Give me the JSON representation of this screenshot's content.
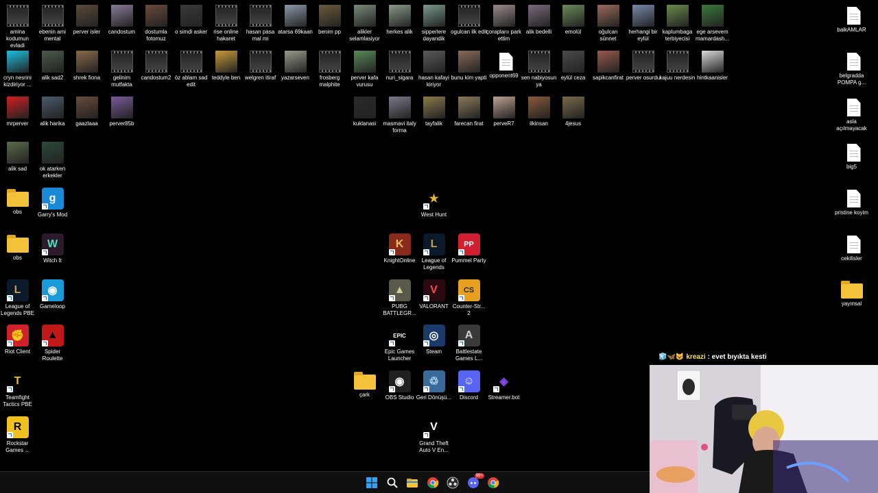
{
  "desktop": {
    "icons": [
      {
        "label": "amina kodumun evladi",
        "kind": "video"
      },
      {
        "label": "ebenin ami mental",
        "kind": "video"
      },
      {
        "label": "perver isler",
        "kind": "photo",
        "color": "#5a4a3a"
      },
      {
        "label": "candostum",
        "kind": "photo",
        "color": "#8a7a9a"
      },
      {
        "label": "dostumla fotomuz",
        "kind": "photo",
        "color": "#6a4a3a"
      },
      {
        "label": "o simdi asker",
        "kind": "photo",
        "color": "#3a3a3a"
      },
      {
        "label": "rise online hakaret",
        "kind": "video"
      },
      {
        "label": "hasan pasa mal mi",
        "kind": "video"
      },
      {
        "label": "atarsa 69kaan",
        "kind": "photo",
        "color": "#8a9aaa"
      },
      {
        "label": "benim pp",
        "kind": "photo",
        "color": "#6a5a3a"
      },
      {
        "label": "alikler selamlasiyor",
        "kind": "photo",
        "color": "#7a8a7a"
      },
      {
        "label": "herkes alik",
        "kind": "photo",
        "color": "#8a9a8a"
      },
      {
        "label": "sipperlere dayandik",
        "kind": "photo",
        "color": "#7a9a8a"
      },
      {
        "label": "ogulcan ilk edit",
        "kind": "video"
      },
      {
        "label": "çoraplarıı park ettim",
        "kind": "photo",
        "color": "#9a8a8a"
      },
      {
        "label": "alik bedelli",
        "kind": "photo",
        "color": "#7a6a7a"
      },
      {
        "label": "emolül",
        "kind": "photo",
        "color": "#6a8a5a"
      },
      {
        "label": "oğulcan sünnet",
        "kind": "photo",
        "color": "#9a6a5a"
      },
      {
        "label": "herhangi bir eylül",
        "kind": "photo",
        "color": "#7a8aaa"
      },
      {
        "label": "kaplumbaga terbiyecisi",
        "kind": "photo",
        "color": "#6a8a4a"
      },
      {
        "label": "ege arsevem mamardash...",
        "kind": "photo",
        "color": "#3a7a3a"
      },
      {
        "label": "balkAMLAR",
        "kind": "doc"
      },
      {
        "label": "cryn nesrini kizdiriyor ...",
        "kind": "photo",
        "color": "#1ec0e0"
      },
      {
        "label": "alik sad2",
        "kind": "photo",
        "color": "#4a5a4a"
      },
      {
        "label": "shrek fiona",
        "kind": "photo",
        "color": "#8a6a4a"
      },
      {
        "label": "gelinim mutfakta",
        "kind": "video"
      },
      {
        "label": "candostum2",
        "kind": "video"
      },
      {
        "label": "öz ablam sad edit",
        "kind": "video"
      },
      {
        "label": "teddyle ben",
        "kind": "photo",
        "color": "#c89a3a"
      },
      {
        "label": "welgren itiraf",
        "kind": "video"
      },
      {
        "label": "yazarseven",
        "kind": "photo",
        "color": "#9a9a8a"
      },
      {
        "label": "frosberg malphite",
        "kind": "video"
      },
      {
        "label": "perver kafa vurusu",
        "kind": "photo",
        "color": "#5a8a5a"
      },
      {
        "label": "nuri_sigara",
        "kind": "video"
      },
      {
        "label": "hasan kafayi kiriyor",
        "kind": "photo",
        "color": "#5a5a5a"
      },
      {
        "label": "bunu kim yapti",
        "kind": "photo",
        "color": "#8a6a5a"
      },
      {
        "label": "opponent69",
        "kind": "doc"
      },
      {
        "label": "sen nabiyosun ya",
        "kind": "video"
      },
      {
        "label": "eylül ceza",
        "kind": "photo",
        "color": "#4a4a4a"
      },
      {
        "label": "sapikcanfirat",
        "kind": "photo",
        "color": "#9a5a4a"
      },
      {
        "label": "perver osurdu",
        "kind": "video"
      },
      {
        "label": "kajuu nerdesin",
        "kind": "video"
      },
      {
        "label": "hintkaanisler",
        "kind": "photo",
        "color": "#dadada"
      },
      {
        "label": "belgradda POMPA g...",
        "kind": "doc"
      },
      {
        "label": "mrperver",
        "kind": "photo",
        "color": "#d02020"
      },
      {
        "label": "alik harika",
        "kind": "photo",
        "color": "#4a5a6a"
      },
      {
        "label": "gaazlaaa",
        "kind": "photo",
        "color": "#6a4a3a"
      },
      {
        "label": "perver85b",
        "kind": "photo",
        "color": "#7a5a9a"
      },
      {
        "label": "kuklanasi",
        "kind": "photo",
        "color": "#2a2a2a"
      },
      {
        "label": "masmavi italy forma",
        "kind": "photo",
        "color": "#7a7a8a"
      },
      {
        "label": "tayfalik",
        "kind": "photo",
        "color": "#8a7a4a"
      },
      {
        "label": "farecan firat",
        "kind": "photo",
        "color": "#8a7a5a"
      },
      {
        "label": "perveR7",
        "kind": "photo",
        "color": "#c0a090"
      },
      {
        "label": "ilkinsan",
        "kind": "photo",
        "color": "#8a5a3a"
      },
      {
        "label": "4jesus",
        "kind": "photo",
        "color": "#7a6a4a"
      },
      {
        "label": "asla açılmayacak",
        "kind": "doc"
      },
      {
        "label": "alik sad",
        "kind": "photo",
        "color": "#5a6a4a"
      },
      {
        "label": "ok atarken erkekler",
        "kind": "photo",
        "color": "#2a4a3a"
      },
      {
        "label": "big5",
        "kind": "doc"
      },
      {
        "label": "obs",
        "kind": "folder"
      },
      {
        "label": "Garry's Mod",
        "kind": "app",
        "color": "#1a8ad8",
        "glyph": "g"
      },
      {
        "label": "West Hunt",
        "kind": "app",
        "color": "#000000",
        "glyph": "★",
        "fg": "#e8b830"
      },
      {
        "label": "pristine koyim",
        "kind": "doc"
      },
      {
        "label": "obs",
        "kind": "folder"
      },
      {
        "label": "Witch It",
        "kind": "app",
        "color": "#2a1a2a",
        "glyph": "W",
        "fg": "#50e0c0"
      },
      {
        "label": "KnightOnline",
        "kind": "app",
        "color": "#8a2a1a",
        "glyph": "K",
        "fg": "#f0c060"
      },
      {
        "label": "League of Legends",
        "kind": "app",
        "color": "#0a1a2a",
        "glyph": "L",
        "fg": "#c8a050"
      },
      {
        "label": "Pummel Party",
        "kind": "app",
        "color": "#d02030",
        "glyph": "PP",
        "fg": "#ffffff"
      },
      {
        "label": "cekilisler",
        "kind": "doc"
      },
      {
        "label": "League of Legends PBE",
        "kind": "app",
        "color": "#0a1a2a",
        "glyph": "L",
        "fg": "#c8a050"
      },
      {
        "label": "Gameloop",
        "kind": "app",
        "color": "#1a9ad8",
        "glyph": "◉",
        "fg": "#ffffff"
      },
      {
        "label": "PUBG BATTLEGR...",
        "kind": "app",
        "color": "#5a5a4a",
        "glyph": "▲",
        "fg": "#d0c8a0"
      },
      {
        "label": "VALORANT",
        "kind": "app",
        "color": "#2a0a10",
        "glyph": "V",
        "fg": "#ff4655"
      },
      {
        "label": "Counter-Str... 2",
        "kind": "app",
        "color": "#e8a020",
        "glyph": "CS",
        "fg": "#1a2a4a"
      },
      {
        "label": "yayınsal",
        "kind": "folder"
      },
      {
        "label": "Riot Client",
        "kind": "app",
        "color": "#d0202a",
        "glyph": "✊",
        "fg": "#ffffff"
      },
      {
        "label": "Spider Roulette",
        "kind": "app",
        "color": "#c01818",
        "glyph": "▲",
        "fg": "#000000"
      },
      {
        "label": "Epic Games Launcher",
        "kind": "app",
        "color": "#000000",
        "glyph": "EPIC",
        "fg": "#ffffff"
      },
      {
        "label": "Steam",
        "kind": "app",
        "color": "#1a3a6a",
        "glyph": "◎",
        "fg": "#ffffff"
      },
      {
        "label": "Battlestate Games L...",
        "kind": "app",
        "color": "#3a3a3a",
        "glyph": "A",
        "fg": "#d0d0d0"
      },
      {
        "label": "Teamfight Tactics PBE",
        "kind": "app",
        "color": "#000000",
        "glyph": "T",
        "fg": "#e8c030"
      },
      {
        "label": "çark",
        "kind": "folder"
      },
      {
        "label": "OBS Studio",
        "kind": "app",
        "color": "#202020",
        "glyph": "◉",
        "fg": "#ffffff"
      },
      {
        "label": "Geri Dönüşü...",
        "kind": "app",
        "color": "#3a6a9a",
        "glyph": "♲",
        "fg": "#c0e0ff"
      },
      {
        "label": "Discord",
        "kind": "app",
        "color": "#5865f2",
        "glyph": "☺",
        "fg": "#ffffff"
      },
      {
        "label": "Streamer.bot",
        "kind": "app",
        "color": "#000000",
        "glyph": "◈",
        "fg": "#8a4af0"
      },
      {
        "label": "Rockstar Games ...",
        "kind": "app",
        "color": "#f0c020",
        "glyph": "R",
        "fg": "#000000"
      },
      {
        "label": "Grand Theft Auto V En...",
        "kind": "app",
        "color": "#000000",
        "glyph": "V",
        "fg": "#ffffff"
      }
    ]
  },
  "taskbar": {
    "items": [
      {
        "name": "start-button",
        "icon": "windows-icon"
      },
      {
        "name": "search-button",
        "icon": "search-icon"
      },
      {
        "name": "file-explorer-button",
        "icon": "folder-icon"
      },
      {
        "name": "chrome-button",
        "icon": "chrome-icon"
      },
      {
        "name": "obs-taskbar-button",
        "icon": "obs-icon"
      },
      {
        "name": "discord-taskbar-button",
        "icon": "discord-icon",
        "badge": "99+"
      },
      {
        "name": "chrome-2-button",
        "icon": "chrome-icon"
      }
    ]
  },
  "overlay": {
    "chat_emotes": "🧊🦋😺",
    "chat_user": "kreazi",
    "chat_message": " : evet bıyıkta kesti"
  }
}
